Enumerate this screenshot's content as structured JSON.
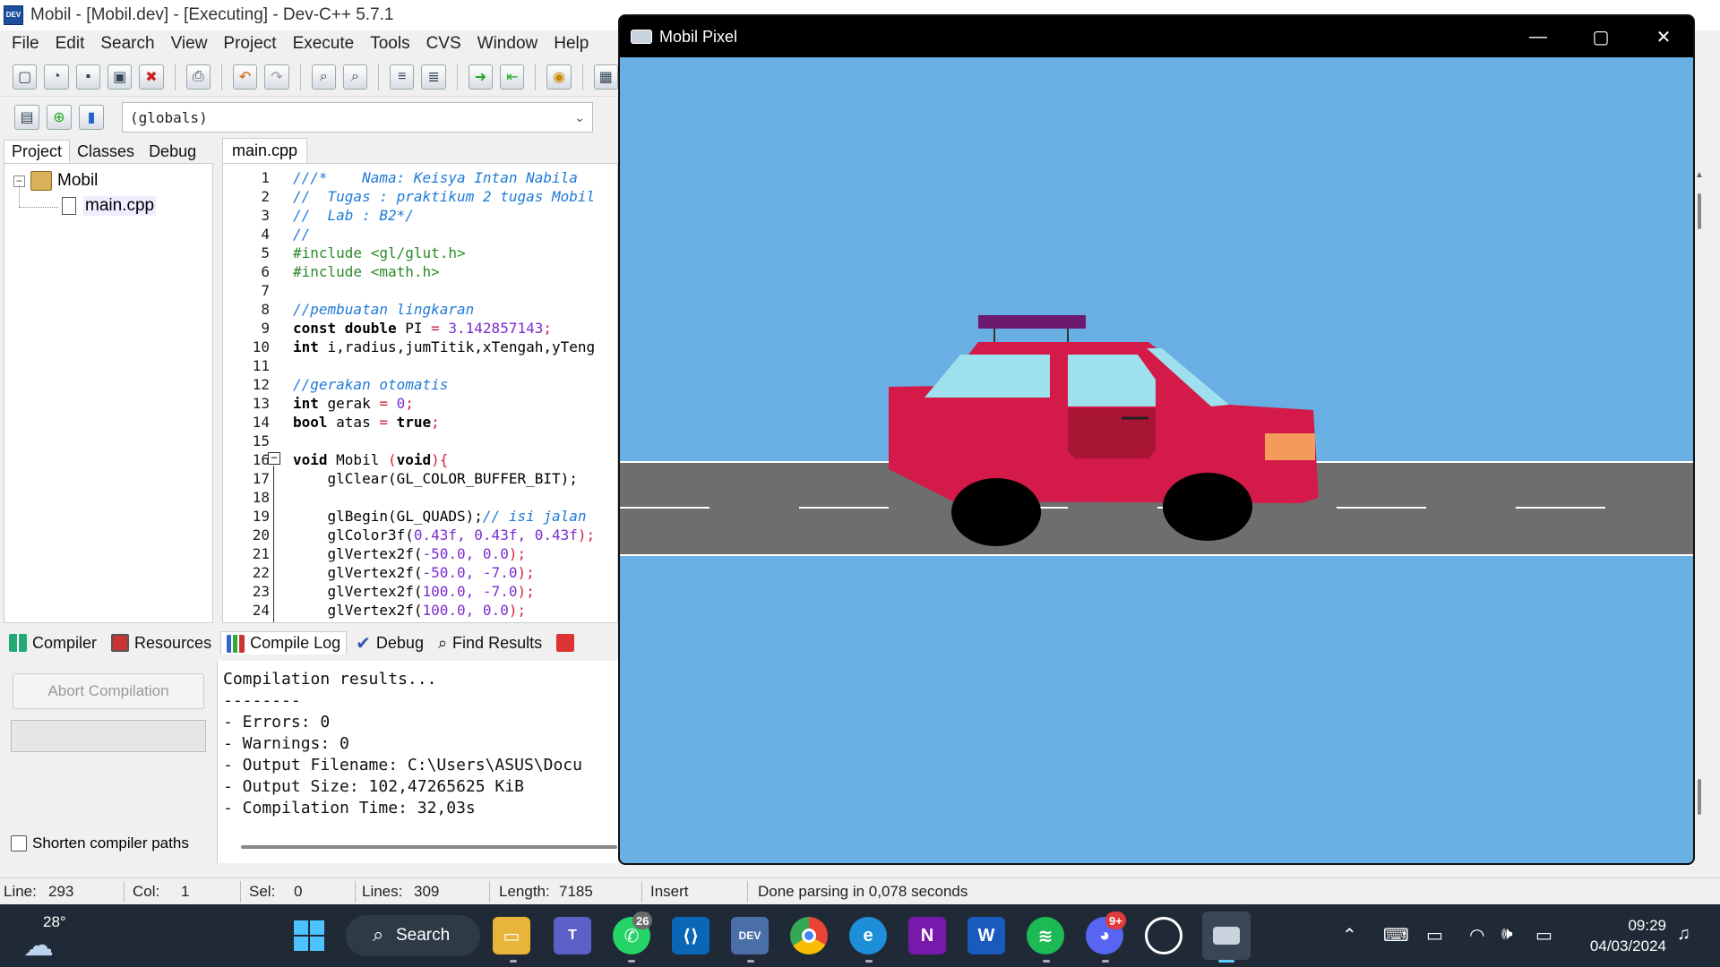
{
  "devcpp": {
    "title": "Mobil - [Mobil.dev] - [Executing] - Dev-C++ 5.7.1",
    "menu": [
      "File",
      "Edit",
      "Search",
      "View",
      "Project",
      "Execute",
      "Tools",
      "CVS",
      "Window",
      "Help"
    ],
    "globals_select": "(globals)",
    "project_tabs": [
      "Project",
      "Classes",
      "Debug"
    ],
    "project_tree": {
      "project": "Mobil",
      "file": "main.cpp"
    },
    "editor_tab": "main.cpp",
    "line_numbers": [
      "1",
      "2",
      "3",
      "4",
      "5",
      "6",
      "7",
      "8",
      "9",
      "10",
      "11",
      "12",
      "13",
      "14",
      "15",
      "16",
      "17",
      "18",
      "19",
      "20",
      "21",
      "22",
      "23",
      "24"
    ],
    "code": {
      "l1": "///*    Nama: Keisya Intan Nabila ",
      "l2": "//  Tugas : praktikum 2 tugas Mobil",
      "l3": "//  Lab : B2*/",
      "l4": "//",
      "l5": "#include <gl/glut.h>",
      "l6": "#include <math.h>",
      "l8": "//pembuatan lingkaran",
      "l9a": "const double",
      "l9b": " PI ",
      "l9c": "= ",
      "l9d": "3.142857143",
      "l9e": ";",
      "l10a": "int",
      "l10b": " i,radius,jumTitik,xTengah,yTeng",
      "l12": "//gerakan otomatis",
      "l13a": "int",
      "l13b": " gerak ",
      "l13c": "= ",
      "l13d": "0",
      "l13e": ";",
      "l14a": "bool",
      "l14b": " atas ",
      "l14c": "= ",
      "l14d": "true",
      "l14e": ";",
      "l16a": "void",
      "l16b": " Mobil ",
      "l16c": "(",
      "l16d": "void",
      "l16e": "){",
      "l17a": "    glClear(GL_COLOR_BUFFER_BIT);",
      "l19a": "    glBegin(GL_QUADS);",
      "l19b": "// isi jalan",
      "l20a": "    glColor3f(",
      "l20b": "0.43f, 0.43f, 0.43f",
      "l20c": ");",
      "l21a": "    glVertex2f(",
      "l21b": "-50.0, 0.0",
      "l21c": ");",
      "l22a": "    glVertex2f(",
      "l22b": "-50.0, -7.0",
      "l22c": ");",
      "l23a": "    glVertex2f(",
      "l23b": "100.0, -7.0",
      "l23c": ");",
      "l24a": "    glVertex2f(",
      "l24b": "100.0, 0.0",
      "l24c": ");"
    },
    "bottom_tabs": [
      "Compiler",
      "Resources",
      "Compile Log",
      "Debug",
      "Find Results"
    ],
    "abort_button": "Abort Compilation",
    "shorten_paths": "Shorten compiler paths",
    "compile_log": [
      "Compilation results...",
      "--------",
      "- Errors: 0",
      "- Warnings: 0",
      "- Output Filename: C:\\Users\\ASUS\\Docu",
      "- Output Size: 102,47265625 KiB",
      "- Compilation Time: 32,03s"
    ],
    "status": {
      "line_label": "Line:",
      "line": "293",
      "col_label": "Col:",
      "col": "1",
      "sel_label": "Sel:",
      "sel": "0",
      "lines_label": "Lines:",
      "lines": "309",
      "length_label": "Length:",
      "length": "7185",
      "mode": "Insert",
      "message": "Done parsing in 0,078 seconds"
    }
  },
  "mobil_pixel": {
    "title": "Mobil Pixel",
    "colors": {
      "sky": "#6aafe3",
      "road": "#6e6e6e",
      "car_body": "#d41a48",
      "window": "#9ee0ee",
      "roof_rack": "#6b1a6e",
      "door": "#a81535",
      "headlight": "#f49a5a",
      "wheel": "#000000"
    }
  },
  "taskbar": {
    "weather_temp": "28°",
    "search_label": "Search",
    "whatsapp_badge": "26",
    "discord_badge": "9+",
    "time": "09:29",
    "date": "04/03/2024"
  }
}
